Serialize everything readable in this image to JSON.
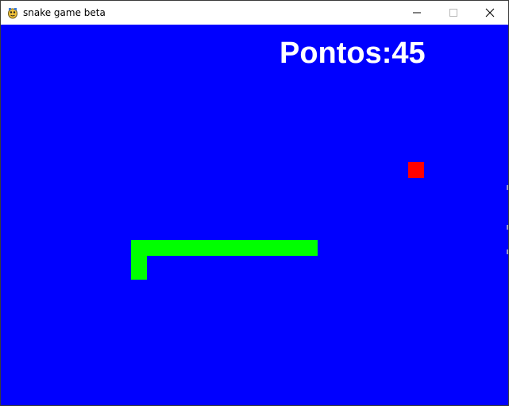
{
  "window": {
    "title": "snake game beta",
    "app_icon": "pygame-snake-icon",
    "controls": [
      "minimize-icon",
      "maximize-icon",
      "close-icon"
    ]
  },
  "game": {
    "background_color": "#0000ff",
    "score_text": "Pontos:45",
    "score_color": "#ffffff",
    "snake_color": "#00ff00",
    "food_color": "#ff0000"
  }
}
